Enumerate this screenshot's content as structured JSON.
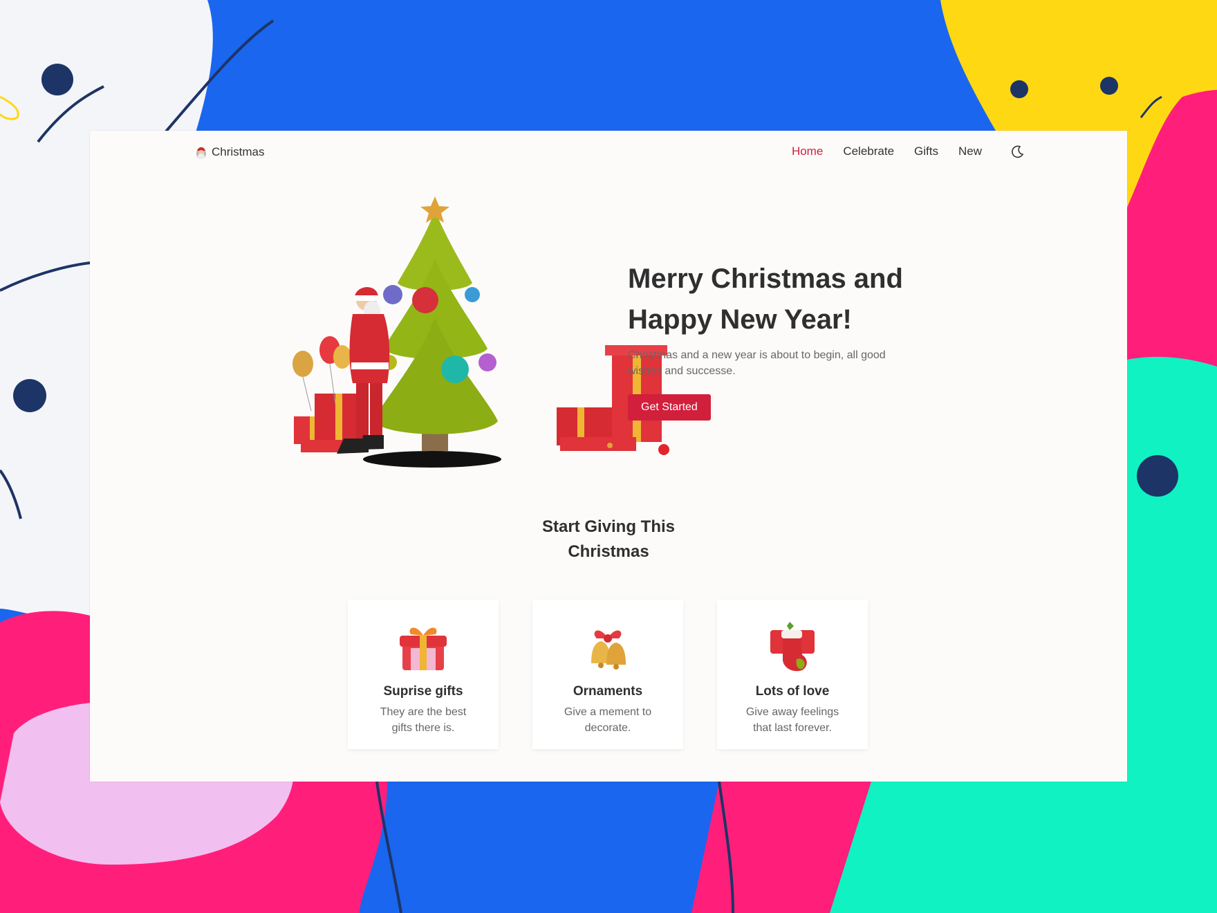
{
  "nav": {
    "brand": "Christmas",
    "items": [
      {
        "label": "Home",
        "active": true
      },
      {
        "label": "Celebrate",
        "active": false
      },
      {
        "label": "Gifts",
        "active": false
      },
      {
        "label": "New",
        "active": false
      }
    ],
    "theme_icon": "moon-icon"
  },
  "hero": {
    "title_line1": "Merry Christmas and",
    "title_line2": "Happy New Year!",
    "description": "Christmas and a new year is about to begin, all good wishes and successe.",
    "cta_label": "Get Started"
  },
  "giving": {
    "title_line1": "Start Giving This",
    "title_line2": "Christmas",
    "cards": [
      {
        "icon": "gift-icon",
        "title": "Suprise gifts",
        "description": "They are the best gifts there is."
      },
      {
        "icon": "bells-icon",
        "title": "Ornaments",
        "description": "Give a mement to decorate."
      },
      {
        "icon": "stocking-icon",
        "title": "Lots of love",
        "description": "Give away feelings that last forever."
      }
    ]
  },
  "colors": {
    "accent": "#d21f3c",
    "text_dark": "#2f2f2f",
    "text_muted": "#666666",
    "page_bg": "#fcfbf9"
  }
}
